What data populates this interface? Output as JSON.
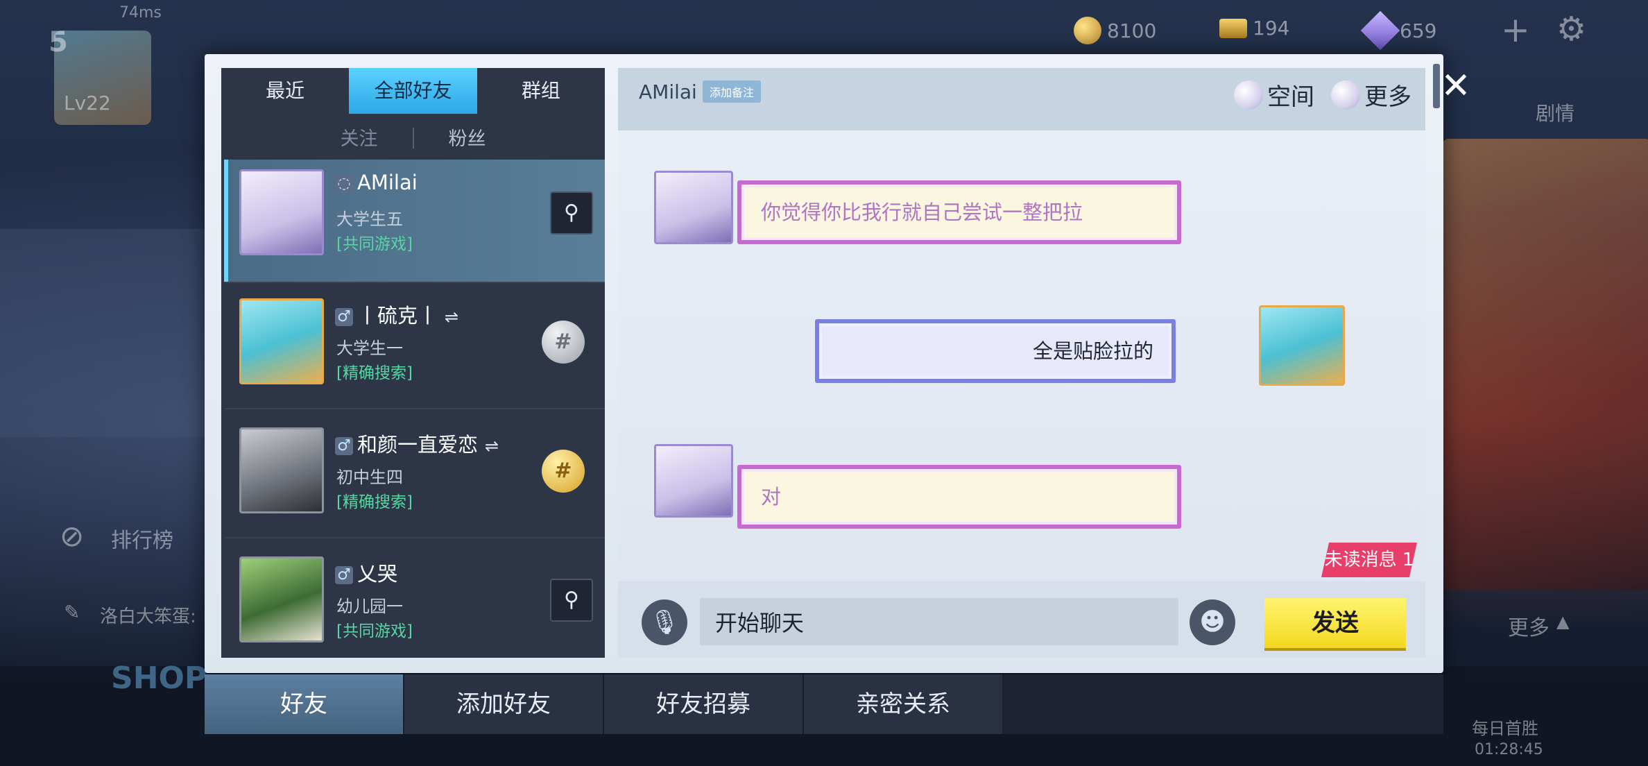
{
  "hud": {
    "ping": "74ms",
    "level": "Lv22",
    "rank_num": "5",
    "gold": "8100",
    "bars": "194",
    "gems": "659",
    "left_menu_label": "排行榜",
    "chat_preview": "洛白大笨蛋:",
    "more_label": "更多",
    "right_story": "剧情",
    "daily_first_win": "每日首胜",
    "timer": "01:28:45",
    "shop_label": "SHOP"
  },
  "friends_panel": {
    "tabs": [
      "最近",
      "全部好友",
      "群组"
    ],
    "active_tab": "全部好友",
    "subtabs": [
      "关注",
      "粉丝"
    ],
    "friends": [
      {
        "name": "AMilai",
        "grade": "大学生五",
        "source": "[共同游戏]",
        "action": "add-icon"
      },
      {
        "name": "丨硫克丨",
        "grade": "大学生一",
        "source": "[精确搜索]",
        "action": "coin-icon"
      },
      {
        "name": "和颜一直爱恋",
        "grade": "初中生四",
        "source": "[精确搜索]",
        "action": "coin-icon"
      },
      {
        "name": "乂哭",
        "grade": "幼儿园一",
        "source": "[共同游戏]",
        "action": "add-icon"
      }
    ]
  },
  "chat": {
    "partner_name": "AMilai",
    "add_remark": "添加备注",
    "space_label": "空间",
    "more_label": "更多",
    "messages": [
      {
        "side": "left",
        "text": "你觉得你比我行就自己尝试一整把拉"
      },
      {
        "side": "right",
        "text": "全是贴脸拉的"
      },
      {
        "side": "left",
        "text": "对"
      }
    ],
    "unread_badge": "未读消息 1",
    "input_value": "开始聊天",
    "send_label": "发送"
  },
  "bottom_tabs": [
    "好友",
    "添加好友",
    "好友招募",
    "亲密关系"
  ],
  "colors": {
    "accent_tab": "#2ea7e6",
    "send_button": "#f2d81f",
    "unread": "#e83e6a",
    "source_green": "#55d6a2"
  }
}
